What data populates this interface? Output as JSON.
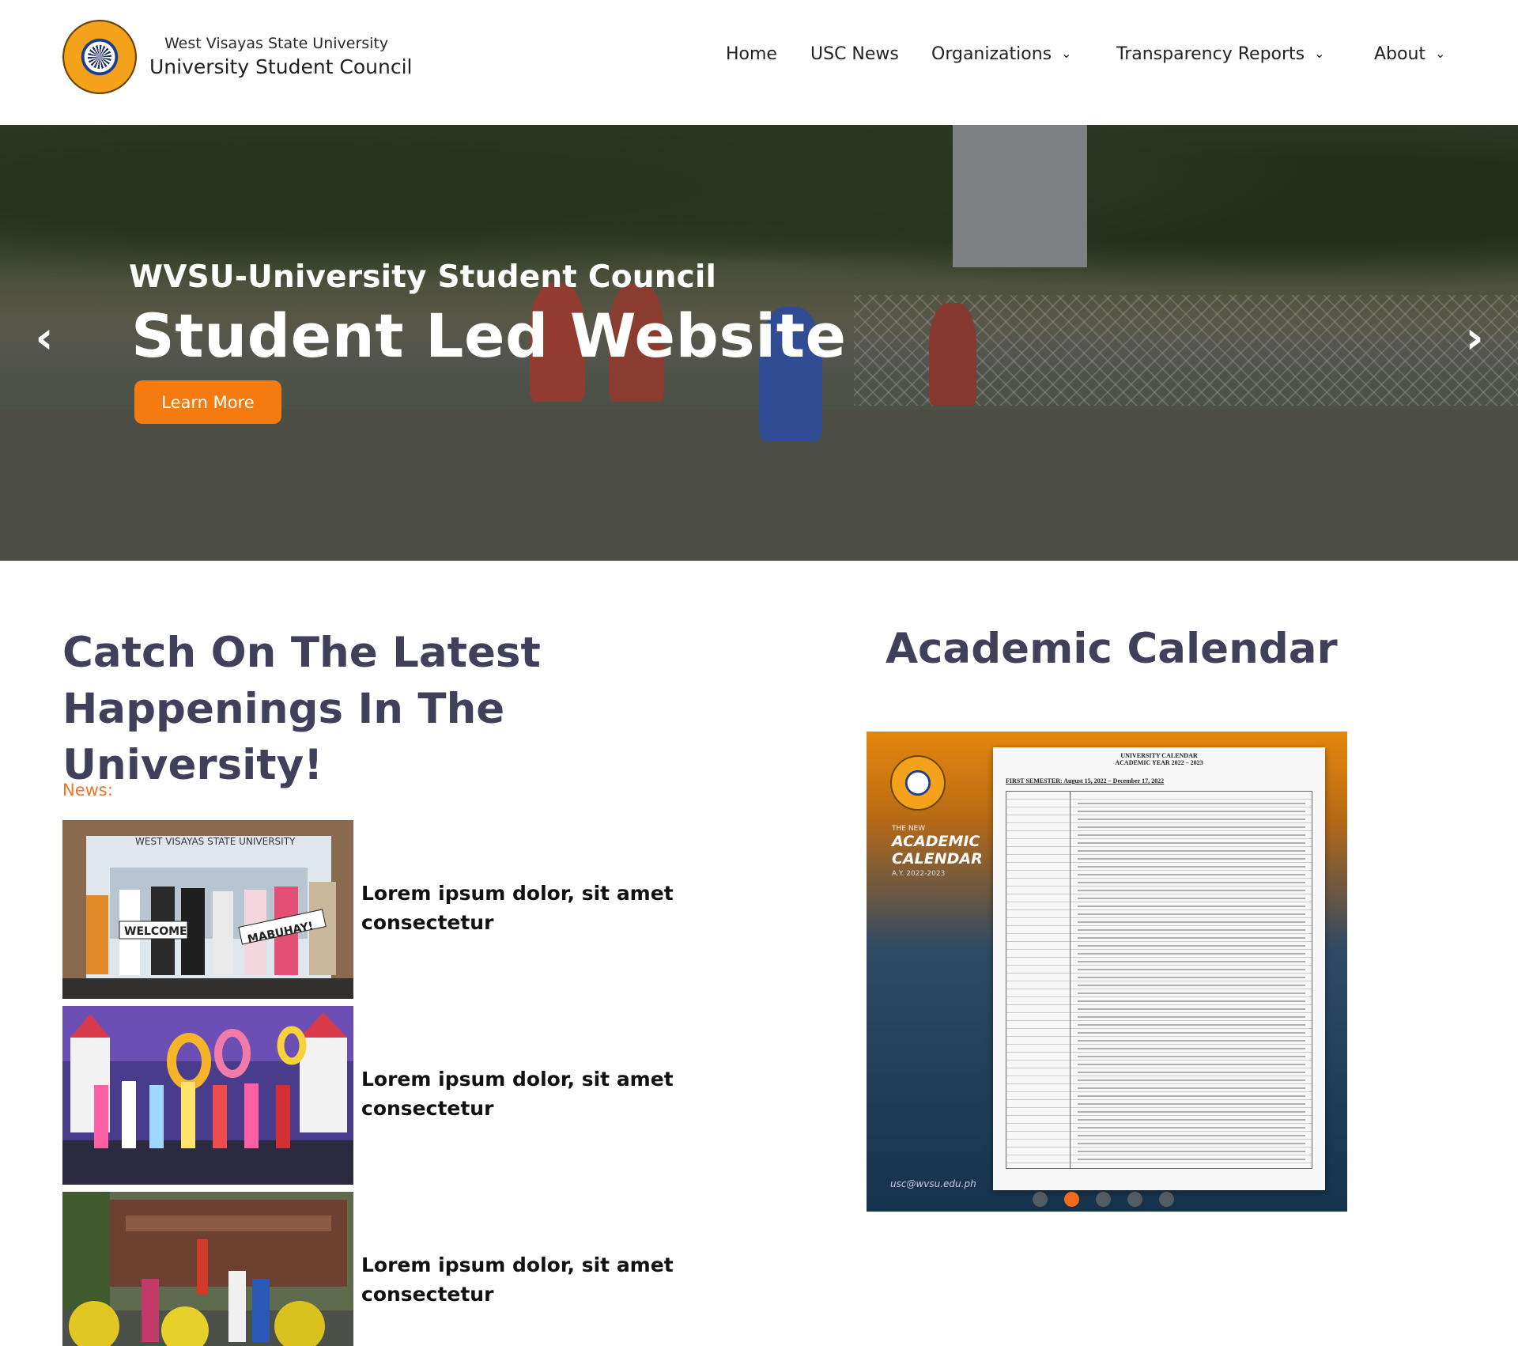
{
  "header": {
    "brand_top": "West Visayas State University",
    "brand_main": "University Student Council",
    "nav": [
      {
        "label": "Home",
        "dropdown": false
      },
      {
        "label": "USC News",
        "dropdown": false
      },
      {
        "label": "Organizations",
        "dropdown": true
      },
      {
        "label": "Transparency Reports",
        "dropdown": true
      },
      {
        "label": "About",
        "dropdown": true
      }
    ]
  },
  "hero": {
    "subtitle": "WVSU-University Student Council",
    "title": "Student Led Website",
    "button_label": "Learn More",
    "prev_icon": "chevron-left-icon",
    "next_icon": "chevron-right-icon",
    "button_color": "#f57a10"
  },
  "news_section": {
    "headline_line1": "Catch On The Latest",
    "headline_line2": "Happenings In The University!",
    "label": "News:",
    "items": [
      {
        "title": "Lorem ipsum dolor, sit amet consectetur",
        "image_text_1": "WEST VISAYAS STATE UNIVERSITY",
        "image_text_2": "WELCOME",
        "image_text_3": "MABUHAY!"
      },
      {
        "title": "Lorem ipsum dolor, sit amet consectetur"
      },
      {
        "title": "Lorem ipsum dolor, sit amet consectetur"
      }
    ]
  },
  "calendar_section": {
    "heading": "Academic Calendar",
    "card": {
      "small_label": "THE NEW",
      "big_line1": "ACADEMIC",
      "big_line2": "CALENDAR",
      "ay": "A.Y. 2022-2023",
      "email": "usc@wvsu.edu.ph",
      "doc_title_1": "UNIVERSITY CALENDAR",
      "doc_title_2": "ACADEMIC YEAR 2022 – 2023",
      "doc_semester": "FIRST SEMESTER:  August 15, 2022 – December 17, 2022"
    },
    "carousel_dots": 5,
    "active_dot": 2
  },
  "colors": {
    "heading": "#40405a",
    "accent": "#f07428"
  }
}
